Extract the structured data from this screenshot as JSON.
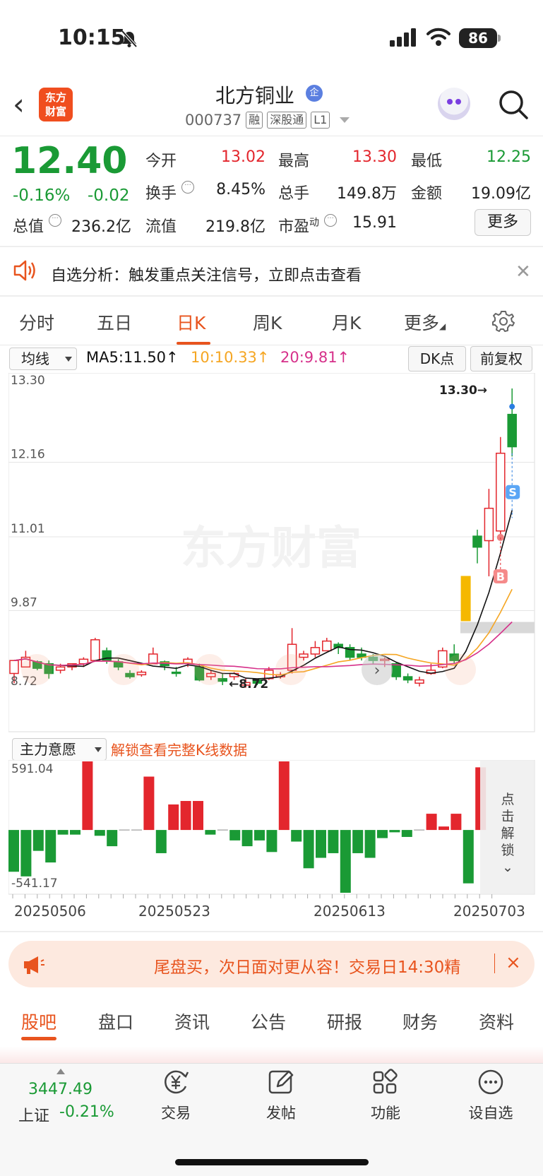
{
  "status": {
    "time": "10:15",
    "battery": "86"
  },
  "header": {
    "back_label": "‹",
    "logo_text": "东方财富",
    "stock_name": "北方铜业",
    "badge": "企",
    "code": "000737",
    "tags": [
      "融",
      "深股通",
      "L1"
    ]
  },
  "quote": {
    "price": "12.40",
    "change_pct": "-0.16%",
    "change_abs": "-0.02",
    "fields": {
      "open_label": "今开",
      "open": "13.02",
      "high_label": "最高",
      "high": "13.30",
      "low_label": "最低",
      "low": "12.25",
      "turnover_label": "换手",
      "turnover": "8.45%",
      "volume_label": "总手",
      "volume": "149.8万",
      "amount_label": "金额",
      "amount": "19.09亿",
      "mktcap_label": "总值",
      "mktcap": "236.2亿",
      "float_label": "流值",
      "float": "219.8亿",
      "pe_label": "市盈",
      "pe_sup": "动",
      "pe": "15.91"
    },
    "more_label": "更多"
  },
  "notice": {
    "text": "自选分析：触发重点关注信号，立即点击查看"
  },
  "chart_tabs": [
    "分时",
    "五日",
    "日K",
    "周K",
    "月K",
    "更多"
  ],
  "active_tab": "日K",
  "ma_bar": {
    "select": "均线",
    "ma5": "MA5:11.50↑",
    "ma10": "10:10.33↑",
    "ma20": "20:9.81↑",
    "dk_button": "DK点",
    "fq_button": "前复权"
  },
  "watermark": "东方财富",
  "lower": {
    "select": "主力意愿",
    "unlock_link": "解锁查看完整K线数据",
    "unlock_vertical": [
      "点",
      "击",
      "解",
      "锁"
    ]
  },
  "colors": {
    "up": "#e3262d",
    "down": "#1a9a35",
    "accent": "#e8541e",
    "ma5": "#111111",
    "ma10": "#f5a623",
    "ma20": "#d6308a"
  },
  "chart_data": [
    {
      "type": "candlestick",
      "title": "日K",
      "y_ticks": [
        "13.30",
        "12.16",
        "11.01",
        "9.87",
        "8.72"
      ],
      "ylim": [
        8.72,
        13.3
      ],
      "annotations": {
        "max_label": "13.30→",
        "min_label": "←8.72",
        "buy_marker": "B",
        "sell_marker": "S"
      },
      "x_dates": [
        "20250506",
        "20250523",
        "20250613",
        "20250703"
      ],
      "candles": [
        [
          8.9,
          9.1,
          8.75,
          9.1
        ],
        [
          9.0,
          9.25,
          9.0,
          9.15
        ],
        [
          9.08,
          9.1,
          8.95,
          8.98
        ],
        [
          9.05,
          9.1,
          8.82,
          8.9
        ],
        [
          8.95,
          9.05,
          8.9,
          9.0
        ],
        [
          9.0,
          9.05,
          8.95,
          9.05
        ],
        [
          9.05,
          9.15,
          9.0,
          9.12
        ],
        [
          9.1,
          9.45,
          9.1,
          9.42
        ],
        [
          9.25,
          9.3,
          9.05,
          9.1
        ],
        [
          9.08,
          9.12,
          8.95,
          9.0
        ],
        [
          8.9,
          8.95,
          8.82,
          8.85
        ],
        [
          8.88,
          8.95,
          8.85,
          8.92
        ],
        [
          9.05,
          9.3,
          9.05,
          9.2
        ],
        [
          9.08,
          9.1,
          8.95,
          9.02
        ],
        [
          8.92,
          9.0,
          8.85,
          8.9
        ],
        [
          9.05,
          9.15,
          9.0,
          9.12
        ],
        [
          9.0,
          9.05,
          8.78,
          8.8
        ],
        [
          8.85,
          8.95,
          8.8,
          8.9
        ],
        [
          8.82,
          8.9,
          8.72,
          8.78
        ],
        [
          8.85,
          8.92,
          8.8,
          8.9
        ],
        [
          8.72,
          8.82,
          8.68,
          8.76
        ],
        [
          8.8,
          8.82,
          8.72,
          8.75
        ],
        [
          8.82,
          9.0,
          8.8,
          8.95
        ],
        [
          8.85,
          8.92,
          8.82,
          8.88
        ],
        [
          8.95,
          9.6,
          8.9,
          9.35
        ],
        [
          9.15,
          9.25,
          9.1,
          9.2
        ],
        [
          9.2,
          9.4,
          9.15,
          9.3
        ],
        [
          9.25,
          9.45,
          9.25,
          9.4
        ],
        [
          9.35,
          9.38,
          9.2,
          9.3
        ],
        [
          9.3,
          9.35,
          9.1,
          9.15
        ],
        [
          9.2,
          9.3,
          9.1,
          9.15
        ],
        [
          9.15,
          9.2,
          9.05,
          9.1
        ],
        [
          9.1,
          9.15,
          9.0,
          9.12
        ],
        [
          9.05,
          9.08,
          8.8,
          8.85
        ],
        [
          8.85,
          8.9,
          8.75,
          8.8
        ],
        [
          8.75,
          8.85,
          8.7,
          8.8
        ],
        [
          8.9,
          9.05,
          8.88,
          8.95
        ],
        [
          9.0,
          9.3,
          8.98,
          9.25
        ],
        [
          9.2,
          9.35,
          9.05,
          9.1
        ],
        [
          10.1,
          10.1,
          10.1,
          10.1
        ],
        [
          11.02,
          11.12,
          10.6,
          10.85
        ],
        [
          10.95,
          11.75,
          10.4,
          11.45
        ],
        [
          11.1,
          12.55,
          11.0,
          12.3
        ],
        [
          12.9,
          13.3,
          12.25,
          12.4
        ]
      ],
      "ma_lines": [
        "MA5",
        "MA10",
        "MA20"
      ]
    },
    {
      "type": "bar",
      "title": "主力意愿",
      "y_ticks": [
        "591.04",
        "-541.17"
      ],
      "ylim": [
        -541.17,
        591.04
      ],
      "values": [
        -360,
        -400,
        -180,
        -280,
        -40,
        -40,
        591,
        -50,
        -140,
        0,
        0,
        460,
        -200,
        220,
        250,
        250,
        -40,
        0,
        -90,
        -140,
        -90,
        -190,
        591,
        -100,
        -330,
        -240,
        -200,
        -541,
        -200,
        -240,
        -70,
        -20,
        -60,
        0,
        140,
        30,
        140,
        -460,
        540
      ]
    }
  ],
  "banner": {
    "text": "尾盘买，次日面对更从容！交易日14:30精",
    "close": "×"
  },
  "bottom_tabs": [
    "股吧",
    "盘口",
    "资讯",
    "公告",
    "研报",
    "财务",
    "资料"
  ],
  "active_bottom_tab": "股吧",
  "index": {
    "value": "3447.49",
    "name": "上证",
    "change": "-0.21%"
  },
  "nav": [
    "交易",
    "发帖",
    "功能",
    "设自选"
  ]
}
